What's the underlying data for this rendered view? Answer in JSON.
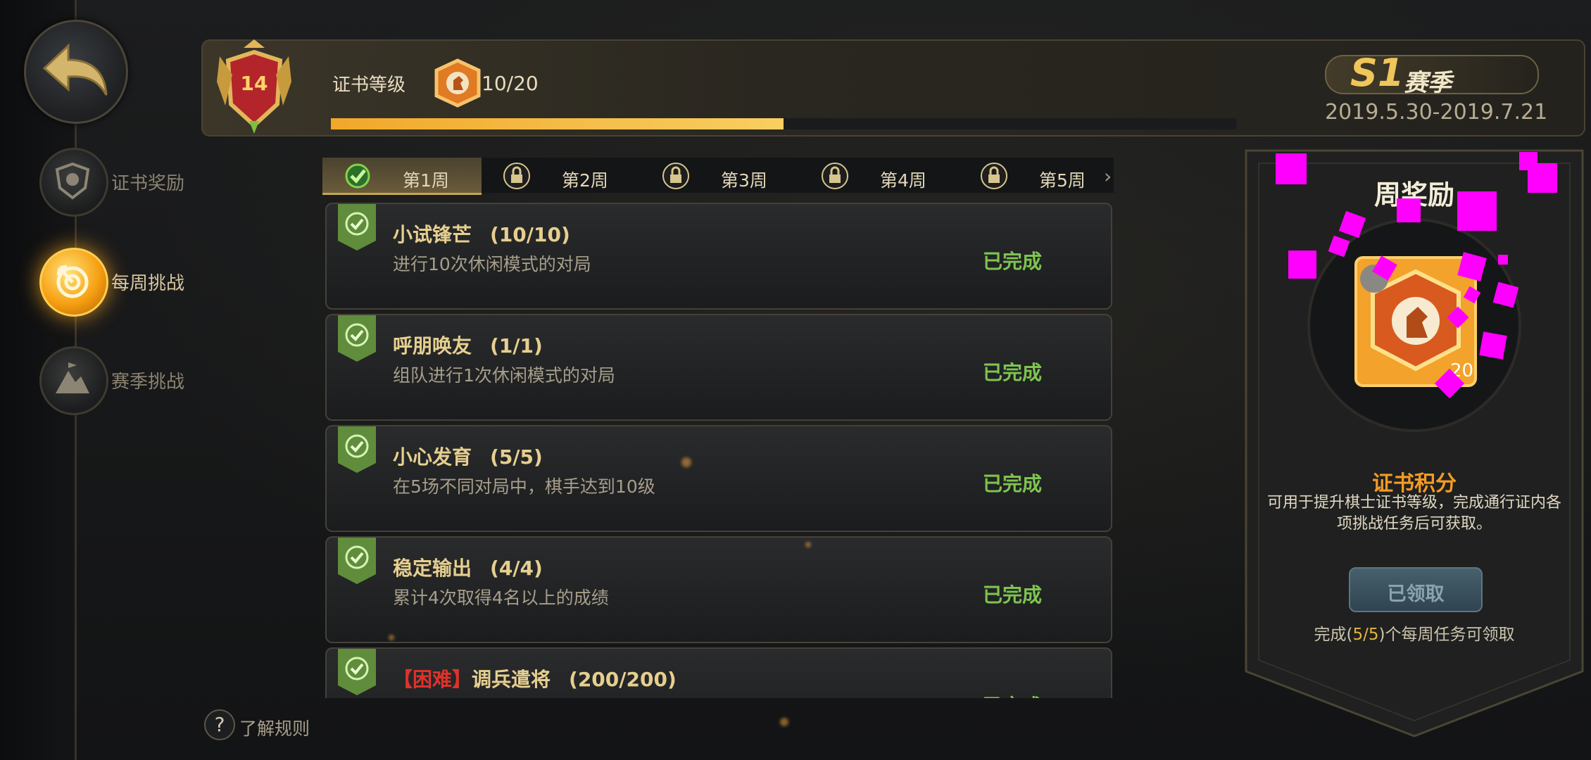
{
  "sidebar": {
    "items": [
      {
        "label": "证书奖励",
        "icon": "shield-emblem-icon",
        "active": false
      },
      {
        "label": "每周挑战",
        "icon": "target-arrow-icon",
        "active": true
      },
      {
        "label": "赛季挑战",
        "icon": "mountain-flag-icon",
        "active": false
      }
    ]
  },
  "header": {
    "level": "14",
    "cert_label": "证书等级",
    "cert_count": "10/20",
    "progress": 0.5,
    "season_code": "S1",
    "season_word": "赛季",
    "season_dates": "2019.5.30-2019.7.21"
  },
  "tabs": [
    {
      "label": "第1周",
      "state": "completed"
    },
    {
      "label": "第2周",
      "state": "locked"
    },
    {
      "label": "第3周",
      "state": "locked"
    },
    {
      "label": "第4周",
      "state": "locked"
    },
    {
      "label": "第5周",
      "state": "locked"
    }
  ],
  "tasks": [
    {
      "prefix": "",
      "title": "小试锋芒",
      "progress": "(10/10)",
      "desc": "进行10次休闲模式的对局",
      "status": "已完成"
    },
    {
      "prefix": "",
      "title": "呼朋唤友",
      "progress": "(1/1)",
      "desc": "组队进行1次休闲模式的对局",
      "status": "已完成"
    },
    {
      "prefix": "",
      "title": "小心发育",
      "progress": "(5/5)",
      "desc": "在5场不同对局中，棋手达到10级",
      "status": "已完成"
    },
    {
      "prefix": "",
      "title": "稳定输出",
      "progress": "(4/4)",
      "desc": "累计4次取得4名以上的成绩",
      "status": "已完成"
    },
    {
      "prefix": "【困难】",
      "title": "调兵遣将",
      "progress": "(200/200)",
      "desc": "",
      "status": "已完成"
    }
  ],
  "rules": {
    "icon_text": "?",
    "label": "了解规则"
  },
  "reward": {
    "title": "周奖励",
    "item_qty": "20",
    "item_name": "证书积分",
    "item_desc": "可用于提升棋士证书等级，完成通行证内各项挑战任务后可获取。",
    "claim_label": "已领取",
    "note_before": "完成(",
    "note_highlight": "5/5",
    "note_after": ")个每周任务可领取"
  },
  "colors": {
    "accent_gold": "#f2b23c",
    "complete_green": "#7ec450",
    "hard_red": "#e0322a",
    "reward_orange": "#f39b24"
  }
}
